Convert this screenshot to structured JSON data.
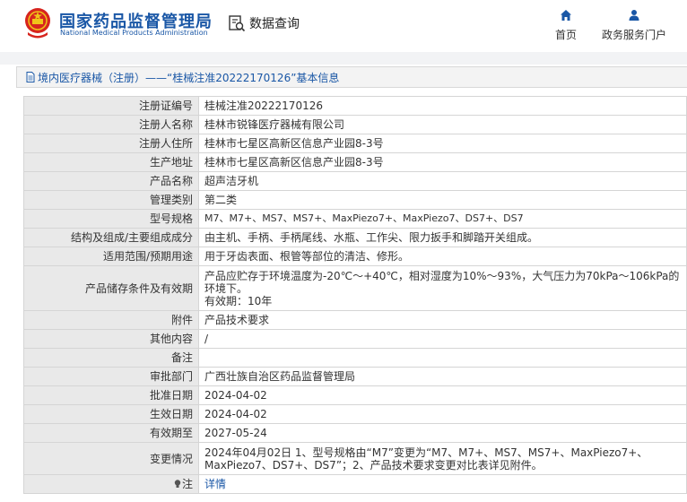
{
  "header": {
    "brand_cn": "国家药品监督管理局",
    "brand_en": "National Medical Products Administration",
    "query_label": "数据查询",
    "nav": {
      "home": "首页",
      "gov_portal": "政务服务门户"
    }
  },
  "panel": {
    "title": "境内医疗器械（注册）——“桂械注准20222170126”基本信息"
  },
  "rows": [
    {
      "label": "注册证编号",
      "value": "桂械注准20222170126"
    },
    {
      "label": "注册人名称",
      "value": "桂林市锐锋医疗器械有限公司"
    },
    {
      "label": "注册人住所",
      "value": "桂林市七星区高新区信息产业园8-3号"
    },
    {
      "label": "生产地址",
      "value": "桂林市七星区高新区信息产业园8-3号"
    },
    {
      "label": "产品名称",
      "value": "超声洁牙机"
    },
    {
      "label": "管理类别",
      "value": "第二类"
    },
    {
      "label": "型号规格",
      "value": "M7、M7+、MS7、MS7+、MaxPiezo7+、MaxPiezo7、DS7+、DS7"
    },
    {
      "label": "结构及组成/主要组成成分",
      "value": "由主机、手柄、手柄尾线、水瓶、工作尖、限力扳手和脚踏开关组成。"
    },
    {
      "label": "适用范围/预期用途",
      "value": "用于牙齿表面、根管等部位的清洁、修形。"
    },
    {
      "label": "产品储存条件及有效期",
      "value": "产品应贮存于环境温度为-20℃～+40℃，相对湿度为10%～93%，大气压力为70kPa～106kPa的环境下。",
      "value2": "有效期：10年"
    },
    {
      "label": "附件",
      "value": "产品技术要求"
    },
    {
      "label": "其他内容",
      "value": "/"
    },
    {
      "label": "备注",
      "value": ""
    },
    {
      "label": "审批部门",
      "value": "广西壮族自治区药品监督管理局"
    },
    {
      "label": "批准日期",
      "value": "2024-04-02"
    },
    {
      "label": "生效日期",
      "value": "2024-04-02"
    },
    {
      "label": "有效期至",
      "value": "2027-05-24"
    },
    {
      "label": "变更情况",
      "value": "2024年04月02日 1、型号规格由“M7”变更为“M7、M7+、MS7、MS7+、MaxPiezo7+、MaxPiezo7、DS7+、DS7”；2、产品技术要求变更对比表详见附件。"
    },
    {
      "label": "注",
      "value": "详情"
    }
  ],
  "colors": {
    "brand_blue": "#1a57a6",
    "label_bg": "#e9e9e9",
    "logo_red": "#d7251e",
    "logo_gold": "#f0c419"
  }
}
